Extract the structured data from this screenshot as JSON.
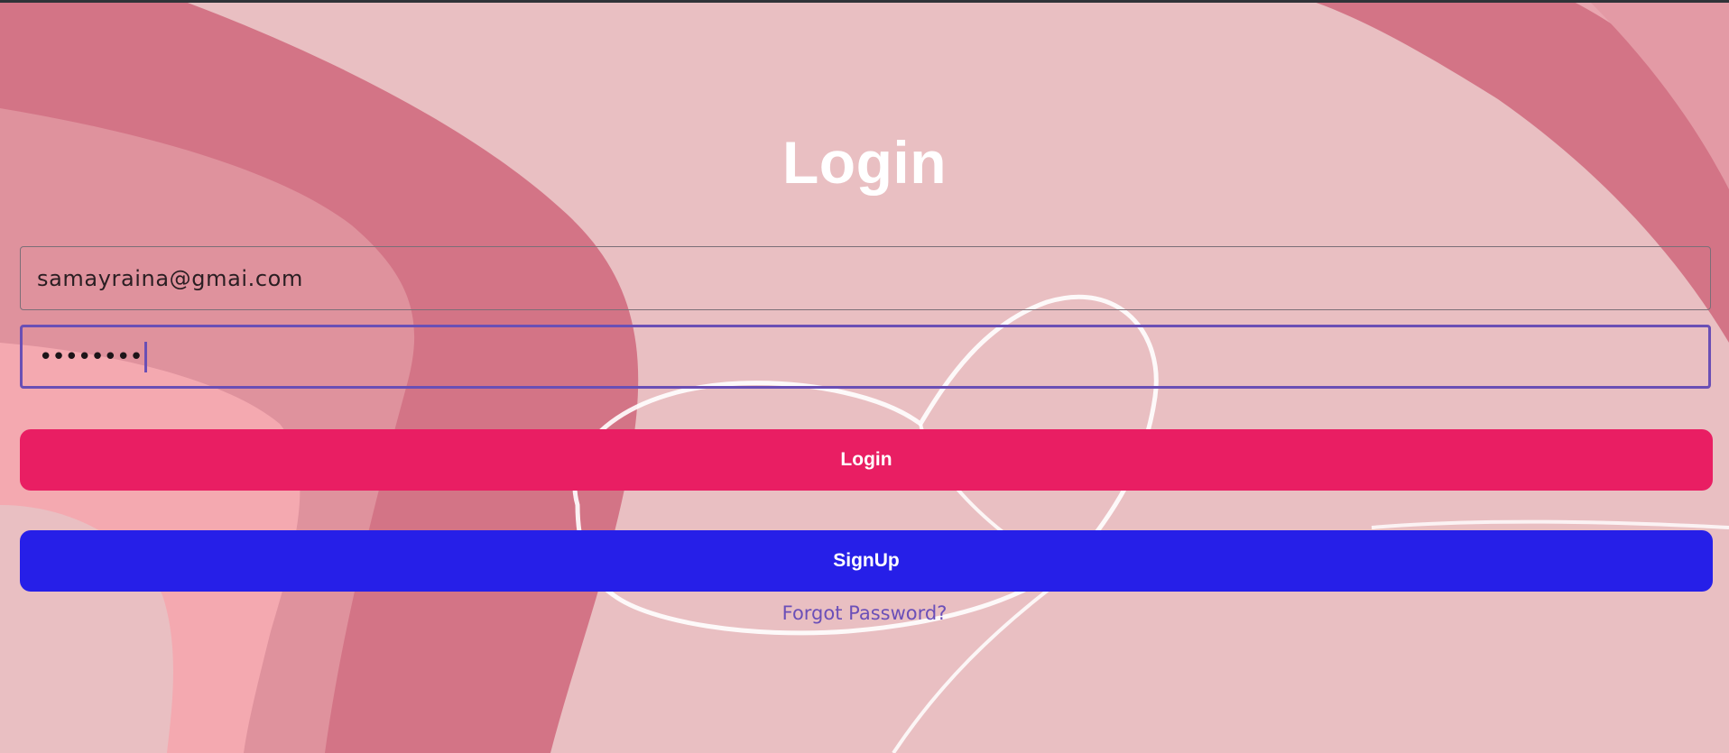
{
  "page": {
    "title": "Login"
  },
  "form": {
    "email_value": "samayraina@gmai.com",
    "password_masked": "••••••••",
    "login_label": "Login",
    "signup_label": "SignUp",
    "forgot_label": "Forgot Password?"
  },
  "colors": {
    "login_button": "#e91e63",
    "signup_button": "#261fe8",
    "focus_border": "#6a4fb5",
    "forgot_link": "#6b4fb8",
    "background": "#e9bfc2"
  }
}
